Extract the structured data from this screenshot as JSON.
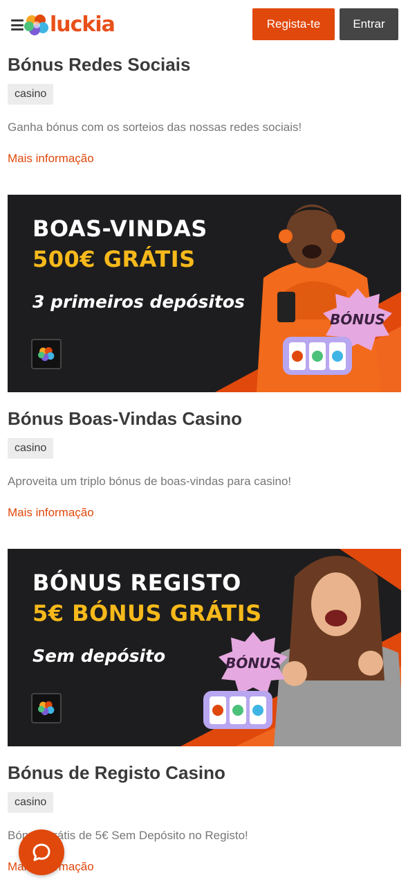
{
  "header": {
    "logo_text": "luckia",
    "register_label": "Regista-te",
    "login_label": "Entrar"
  },
  "promos": [
    {
      "title": "Bónus Redes Sociais",
      "tag": "casino",
      "description": "Ganha bónus com os sorteios das nossas redes sociais!",
      "link": "Mais informação"
    },
    {
      "title": "Bónus Boas-Vindas Casino",
      "tag": "casino",
      "description": "Aproveita um triplo bónus de boas-vindas para casino!",
      "link": "Mais informação",
      "banner": {
        "line1": "BOAS-VINDAS",
        "line2": "500€ GRÁTIS",
        "line3": "3 primeiros depósitos",
        "stamp": "BÓNUS"
      }
    },
    {
      "title": "Bónus de Registo Casino",
      "tag": "casino",
      "description": "Bónus Grátis de 5€ Sem Depósito no Registo!",
      "link": "Mais informação",
      "banner": {
        "line1": "BÓNUS REGISTO",
        "line2": "5€ BÓNUS GRÁTIS",
        "line3": "Sem depósito",
        "stamp": "BÓNUS"
      }
    }
  ],
  "colors": {
    "brand_orange": "#e0480c",
    "banner_yellow": "#f6b91b",
    "dark_button": "#454545"
  },
  "icons": {
    "menu": "hamburger-icon",
    "chat": "chat-bubble-icon"
  }
}
